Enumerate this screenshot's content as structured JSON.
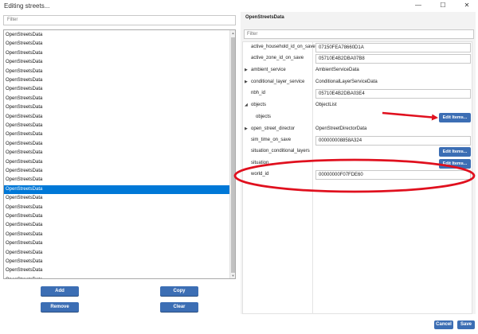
{
  "window": {
    "title": "Editing streets...",
    "minimize": "—",
    "maximize": "☐",
    "close": "✕"
  },
  "left": {
    "filter_placeholder": "Filter",
    "items": [
      "OpenStreetsData",
      "OpenStreetsData",
      "OpenStreetsData",
      "OpenStreetsData",
      "OpenStreetsData",
      "OpenStreetsData",
      "OpenStreetsData",
      "OpenStreetsData",
      "OpenStreetsData",
      "OpenStreetsData",
      "OpenStreetsData",
      "OpenStreetsData",
      "OpenStreetsData",
      "OpenStreetsData",
      "OpenStreetsData",
      "OpenStreetsData",
      "OpenStreetsData",
      "OpenStreetsData",
      "OpenStreetsData",
      "OpenStreetsData",
      "OpenStreetsData",
      "OpenStreetsData",
      "OpenStreetsData",
      "OpenStreetsData",
      "OpenStreetsData",
      "OpenStreetsData",
      "OpenStreetsData",
      "OpenStreetsData"
    ],
    "selected_index": 17,
    "buttons": {
      "add": "Add",
      "copy": "Copy",
      "remove": "Remove",
      "clear": "Clear"
    }
  },
  "right": {
    "header": "OpenStreetsData",
    "filter_placeholder": "Filter",
    "properties": [
      {
        "name": "active_household_id_on_save",
        "value": "07150FEA78660D1A",
        "kind": "input"
      },
      {
        "name": "active_zone_id_on_save",
        "value": "05710E4B2DBA07B8",
        "kind": "input"
      },
      {
        "name": "ambient_service",
        "value": "AmbientServiceData",
        "kind": "text",
        "expander": "▶"
      },
      {
        "name": "conditional_layer_service",
        "value": "ConditionalLayerServiceData",
        "kind": "text",
        "expander": "▶"
      },
      {
        "name": "nbh_id",
        "value": "05710E4B2DBA03E4",
        "kind": "input"
      },
      {
        "name": "objects",
        "value": "ObjectList",
        "kind": "text",
        "expander": "◢"
      },
      {
        "name": "objects",
        "value": "Edit Items...",
        "kind": "button",
        "indent": true
      },
      {
        "name": "open_street_director",
        "value": "OpenStreetDirectorData",
        "kind": "text",
        "expander": "▶"
      },
      {
        "name": "sim_time_on_save",
        "value": "000000008858A324",
        "kind": "input"
      },
      {
        "name": "situation_conditional_layers",
        "value": "Edit Items...",
        "kind": "button"
      },
      {
        "name": "situation_...",
        "value": "Edit Items...",
        "kind": "button"
      },
      {
        "name": "world_id",
        "value": "00000000F07FDE60",
        "kind": "input"
      }
    ]
  },
  "footer": {
    "cancel": "Cancel",
    "save": "Save"
  },
  "annotation_color": "#e0101e",
  "accent": "#3c6eb4",
  "selection_color": "#0078d7"
}
